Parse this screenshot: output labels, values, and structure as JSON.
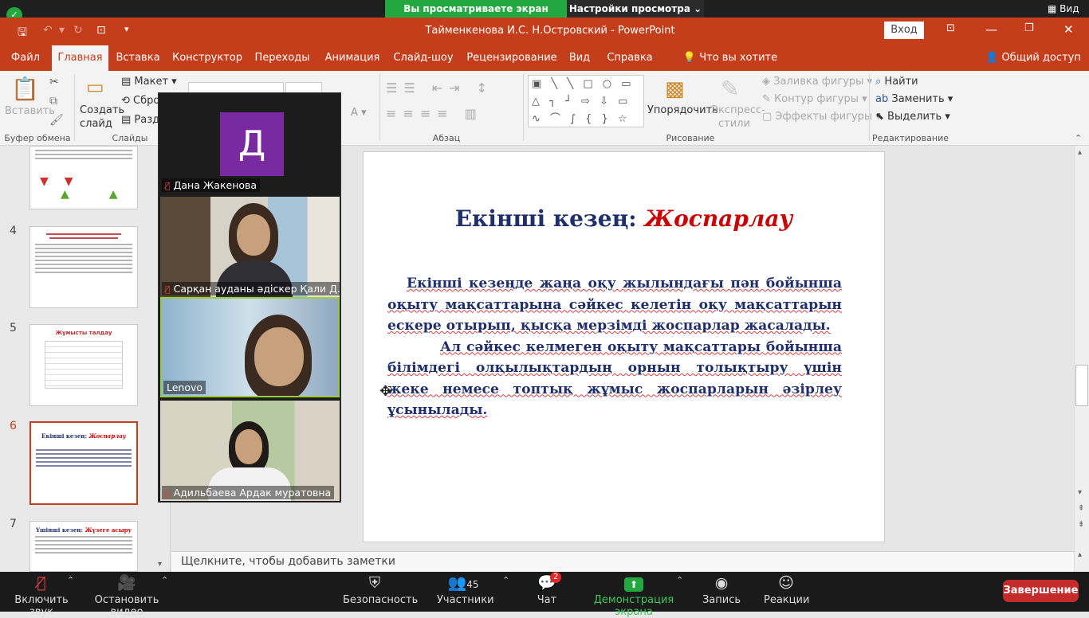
{
  "zoom_top": {
    "share_banner": "Вы просматриваете экран Lenovo",
    "view_options": "Настройки просмотра ⌄",
    "view_button": "Вид"
  },
  "window": {
    "title": "Тайменкенова И.С. Н.Островский  -  PowerPoint",
    "login": "Вход"
  },
  "tabs": [
    "Файл",
    "Главная",
    "Вставка",
    "Конструктор",
    "Переходы",
    "Анимация",
    "Слайд-шоу",
    "Рецензирование",
    "Вид",
    "Справка"
  ],
  "tell_me": "Что вы хотите сделать?",
  "share": "Общий доступ",
  "ribbon": {
    "paste": "Вставить",
    "clipboard_group": "Буфер обмена",
    "new_slide_1": "Создать",
    "new_slide_2": "слайд",
    "layout": "Макет",
    "reset": "Сбро",
    "section": "Разде",
    "slides_group": "Слайды",
    "paragraph_group": "Абзац",
    "arrange": "Упорядочить",
    "quick_styles_1": "Экспресс-",
    "quick_styles_2": "стили",
    "fill": "Заливка фигуры",
    "outline": "Контур фигуры",
    "effects": "Эффекты фигуры",
    "drawing_group": "Рисование",
    "find": "Найти",
    "replace": "Заменить",
    "select": "Выделить",
    "editing_group": "Редактирование"
  },
  "thumbnails": {
    "n4": "4",
    "n5": "5",
    "n6": "6",
    "n7": "7",
    "t5": "Жұмысты талдау",
    "t6_a": "Екінші кезең: ",
    "t6_b": "Жоспарлау",
    "t7_a": "Үшінші кезең: ",
    "t7_b": "Жүзеге асыру"
  },
  "slide": {
    "title_a": "Екінші кезең: ",
    "title_b": "Жоспарлау",
    "para1": "Екінші кезеңде жаңа оқу жылындағы пән бойынша оқыту мақсаттарына сәйкес келетін оқу мақсаттарын ескере отырып, қысқа мерзімді жоспарлар жасалады.",
    "para2": "Ал сәйкес келмеген оқыту мақсаттары бойынша білімдегі олқылықтардың орнын толықтыру үшін жеке немесе топтық жұмыс жоспарларын әзірлеу ұсынылады."
  },
  "notes_placeholder": "Щелкните, чтобы добавить заметки",
  "gallery": {
    "p1_initial": "Д",
    "p1_name": "Дана Жакенова",
    "p2_name": "Сарқан ауданы әдіскер Қали Д...",
    "p3_name": "Lenovo",
    "p4_name": "Адильбаева Ардак муратовна"
  },
  "zoom_bottom": {
    "unmute": "Включить звук",
    "stop_video": "Остановить видео",
    "security": "Безопасность",
    "participants": "Участники",
    "participants_count": "45",
    "chat": "Чат",
    "chat_badge": "2",
    "share_screen": "Демонстрация экрана",
    "record": "Запись",
    "reactions": "Реакции",
    "end": "Завершение"
  },
  "colors": {
    "ribbon_accent": "#c43e1c",
    "zoom_green": "#23a73f",
    "slide_title": "#1f2f6b",
    "slide_title_accent": "#cc0000",
    "end_button": "#c42b2b"
  }
}
